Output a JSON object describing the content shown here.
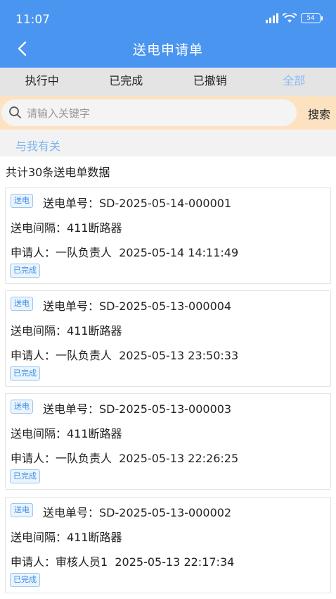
{
  "status_bar": {
    "time": "11:07",
    "battery": "54"
  },
  "header": {
    "title": "送电申请单"
  },
  "tabs": [
    "执行中",
    "已完成",
    "已撤销",
    "全部"
  ],
  "search": {
    "placeholder": "请输入关键字",
    "button": "搜索"
  },
  "filter": {
    "label": "与我有关"
  },
  "summary": "共计30条送电单数据",
  "records": [
    {
      "tag": "送电",
      "number_label": "送电单号：",
      "number": "SD-2025-05-14-000001",
      "interval_label": "送电间隔：",
      "interval": "411断路器",
      "applicant_label": "申请人：",
      "applicant": "一队负责人",
      "datetime": "2025-05-14 14:11:49",
      "status": "已完成"
    },
    {
      "tag": "送电",
      "number_label": "送电单号：",
      "number": "SD-2025-05-13-000004",
      "interval_label": "送电间隔：",
      "interval": "411断路器",
      "applicant_label": "申请人：",
      "applicant": "一队负责人",
      "datetime": "2025-05-13 23:50:33",
      "status": "已完成"
    },
    {
      "tag": "送电",
      "number_label": "送电单号：",
      "number": "SD-2025-05-13-000003",
      "interval_label": "送电间隔：",
      "interval": "411断路器",
      "applicant_label": "申请人：",
      "applicant": "一队负责人",
      "datetime": "2025-05-13 22:26:25",
      "status": "已完成"
    },
    {
      "tag": "送电",
      "number_label": "送电单号：",
      "number": "SD-2025-05-13-000002",
      "interval_label": "送电间隔：",
      "interval": "411断路器",
      "applicant_label": "申请人：",
      "applicant": "审核人员1",
      "datetime": "2025-05-13 22:17:34",
      "status": "已完成"
    }
  ]
}
